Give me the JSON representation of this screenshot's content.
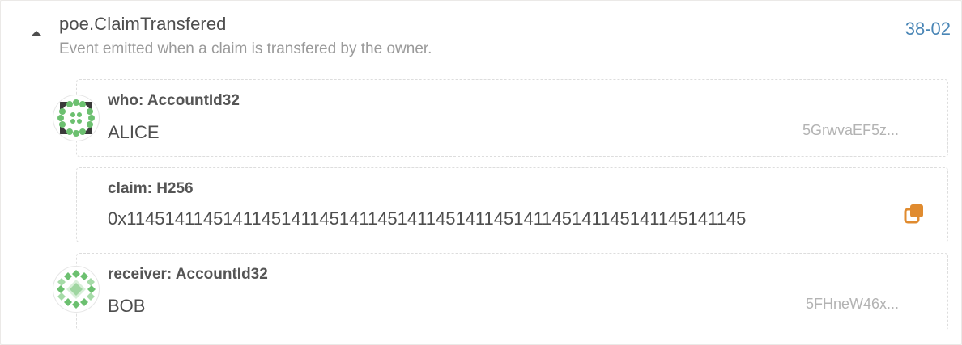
{
  "event": {
    "title": "poe.ClaimTransfered",
    "description": "Event emitted when a claim is transfered by the owner.",
    "block_ref": "38-02"
  },
  "params": [
    {
      "label": "who: AccountId32",
      "value": "ALICE",
      "address": "5GrwvaEF5z...",
      "icon": "identicon-alice"
    },
    {
      "label": "claim: H256",
      "value": "0x1145141145141145141145141145141145141145141145141145141145141145",
      "icon": "copy-icon"
    },
    {
      "label": "receiver: AccountId32",
      "value": "BOB",
      "address": "5FHneW46x...",
      "icon": "identicon-bob"
    }
  ],
  "colors": {
    "accent_link": "#4a86b6",
    "copy_icon": "#e08b2f",
    "identicon_green": "#6cc070"
  }
}
